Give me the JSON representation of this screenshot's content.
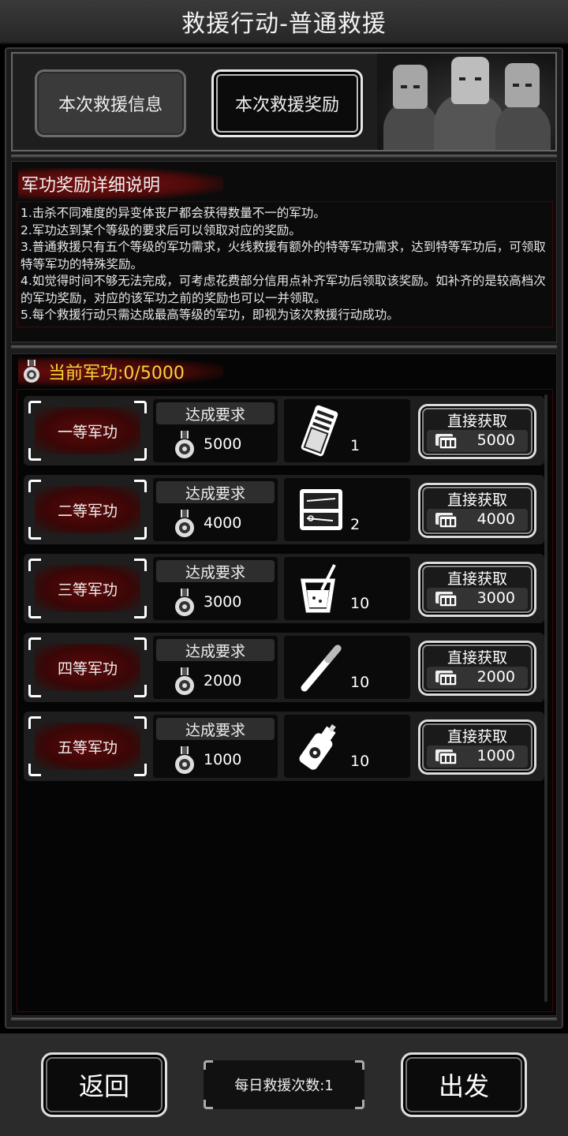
{
  "title": "救援行动-普通救援",
  "tabs": {
    "info_label": "本次救援信息",
    "reward_label": "本次救援奖励"
  },
  "info": {
    "heading": "军功奖励详细说明",
    "lines": [
      "1.击杀不同难度的异变体丧尸都会获得数量不一的军功。",
      "2.军功达到某个等级的要求后可以领取对应的奖励。",
      "3.普通救援只有五个等级的军功需求，火线救援有额外的特等军功需求，达到特等军功后，可领取特等军功的特殊奖励。",
      "4.如觉得时间不够无法完成，可考虑花费部分信用点补齐军功后领取该奖励。如补齐的是较高档次的军功奖励，对应的该军功之前的奖励也可以一并领取。",
      "5.每个救援行动只需达成最高等级的军功，即视为该次救援行动成功。"
    ]
  },
  "current_merit": "当前军功:0/5000",
  "rows": [
    {
      "grade": "一等军功",
      "req_title": "达成要求",
      "req_value": "5000",
      "reward_icon": "first-aid-kit-icon",
      "reward_qty": "1",
      "buy_title": "直接获取",
      "price": "5000"
    },
    {
      "grade": "二等军功",
      "req_title": "达成要求",
      "req_value": "4000",
      "reward_icon": "surgical-kit-icon",
      "reward_qty": "2",
      "buy_title": "直接获取",
      "price": "4000"
    },
    {
      "grade": "三等军功",
      "req_title": "达成要求",
      "req_value": "3000",
      "reward_icon": "drink-cup-icon",
      "reward_qty": "10",
      "buy_title": "直接获取",
      "price": "3000"
    },
    {
      "grade": "四等军功",
      "req_title": "达成要求",
      "req_value": "2000",
      "reward_icon": "cigarette-icon",
      "reward_qty": "10",
      "buy_title": "直接获取",
      "price": "2000"
    },
    {
      "grade": "五等军功",
      "req_title": "达成要求",
      "req_value": "1000",
      "reward_icon": "spray-bottle-icon",
      "reward_qty": "10",
      "buy_title": "直接获取",
      "price": "1000"
    }
  ],
  "bottom": {
    "back_label": "返回",
    "daily_label": "每日救援次数:1",
    "go_label": "出发"
  }
}
